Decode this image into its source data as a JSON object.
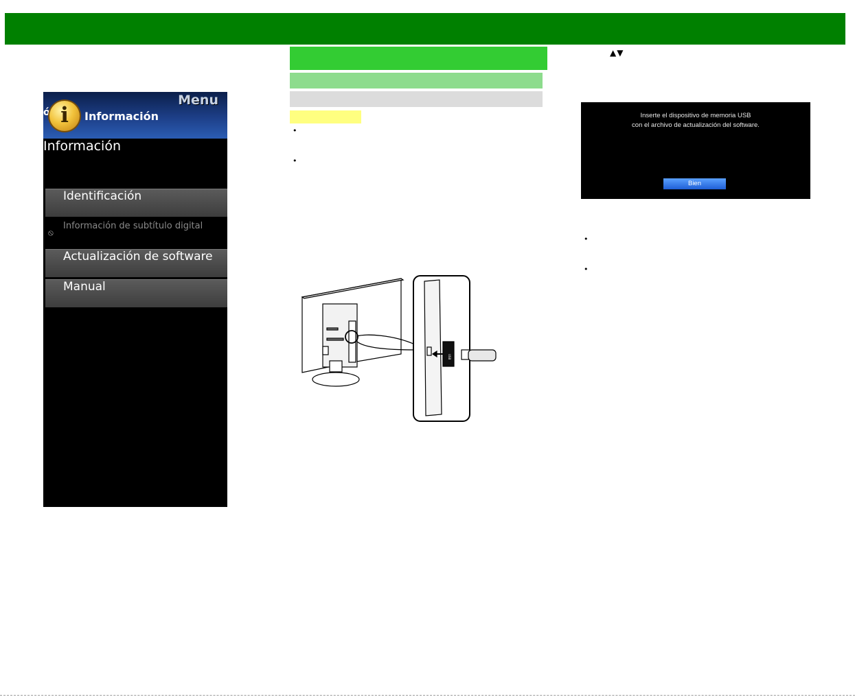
{
  "osd": {
    "menu_label": "Menu",
    "header_title": "Información",
    "icon": "info-icon",
    "section_title": "Información",
    "items": [
      {
        "label": "Identificación",
        "enabled": true
      },
      {
        "label": "Información de subtítulo digital",
        "enabled": false
      },
      {
        "label": "Actualización de software",
        "enabled": true
      },
      {
        "label": "Manual",
        "enabled": true
      }
    ]
  },
  "middle": {
    "bullet_1": "•",
    "bullet_2": "•"
  },
  "right": {
    "arrows": "▲▼",
    "dialog": {
      "line_1": "Inserte el dispositivo de memoria USB",
      "line_2": "con el archivo de actualización del software.",
      "ok_label": "Bien"
    },
    "bullet_1": "•",
    "bullet_2": "•"
  },
  "colors": {
    "top_bar": "#008000",
    "section_bar": "#33cc33",
    "sub_bar": "#8ddc8d",
    "gray_bar": "#dcdcdc",
    "note_bar": "#ffff80"
  }
}
